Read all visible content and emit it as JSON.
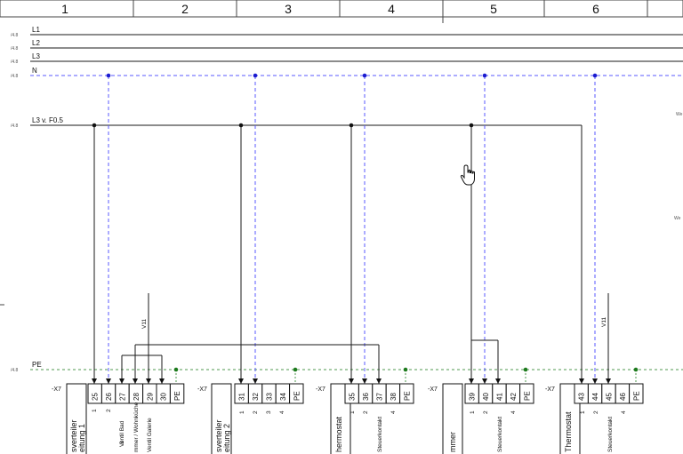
{
  "columns": [
    "1",
    "2",
    "3",
    "4",
    "5",
    "6"
  ],
  "rails": {
    "ref": "/4.8",
    "L1": "L1",
    "L2": "L2",
    "L3": "L3",
    "N": "N",
    "L3_branch": "L3 v. F0.5",
    "PE": "PE"
  },
  "right_margin_text": [
    "We",
    "We"
  ],
  "vertical_labels": [
    "V11",
    "V11"
  ],
  "terminal_strip_label": "-X7",
  "groups": [
    {
      "terminals": [
        "25",
        "26",
        "27",
        "28",
        "29",
        "30",
        "PE"
      ],
      "wire_numbers": [
        "1",
        "2",
        "3"
      ],
      "notes": [
        "Ventil Bad",
        "mmer / Wohnküche",
        "Ventil Galerie"
      ],
      "block_lines": [
        "sverteiler",
        "eitung 1"
      ]
    },
    {
      "terminals": [
        "31",
        "32",
        "33",
        "34",
        "PE"
      ],
      "wire_numbers": [
        "1",
        "2",
        "3",
        "4"
      ],
      "notes": [],
      "block_lines": [
        "sverteiler",
        "eitung 2"
      ]
    },
    {
      "terminals": [
        "35",
        "36",
        "37",
        "38",
        "PE"
      ],
      "wire_numbers": [
        "1",
        "2",
        "4"
      ],
      "notes": [
        "Steuerkontakt"
      ],
      "block_lines": [
        "hermostat"
      ]
    },
    {
      "terminals": [
        "39",
        "40",
        "41",
        "42",
        "PE"
      ],
      "wire_numbers": [
        "1",
        "2",
        "4"
      ],
      "notes": [
        "Steuerkontakt"
      ],
      "block_lines": [
        "mmer"
      ]
    },
    {
      "terminals": [
        "43",
        "44",
        "45",
        "46",
        "PE"
      ],
      "wire_numbers": [
        "1",
        "2",
        "4"
      ],
      "notes": [
        "Steuerkontakt"
      ],
      "block_lines": [
        "Thermostat"
      ]
    }
  ],
  "colors": {
    "line": "#1a1a1a",
    "neutral_dash": "#5a5aff",
    "neutral_dot": "#1b1bd0",
    "pe_dash": "#4f9a4f",
    "pe_dot": "#1d7a1d",
    "grid": "#444444"
  },
  "cursor_icon": "hand-pointer-icon"
}
